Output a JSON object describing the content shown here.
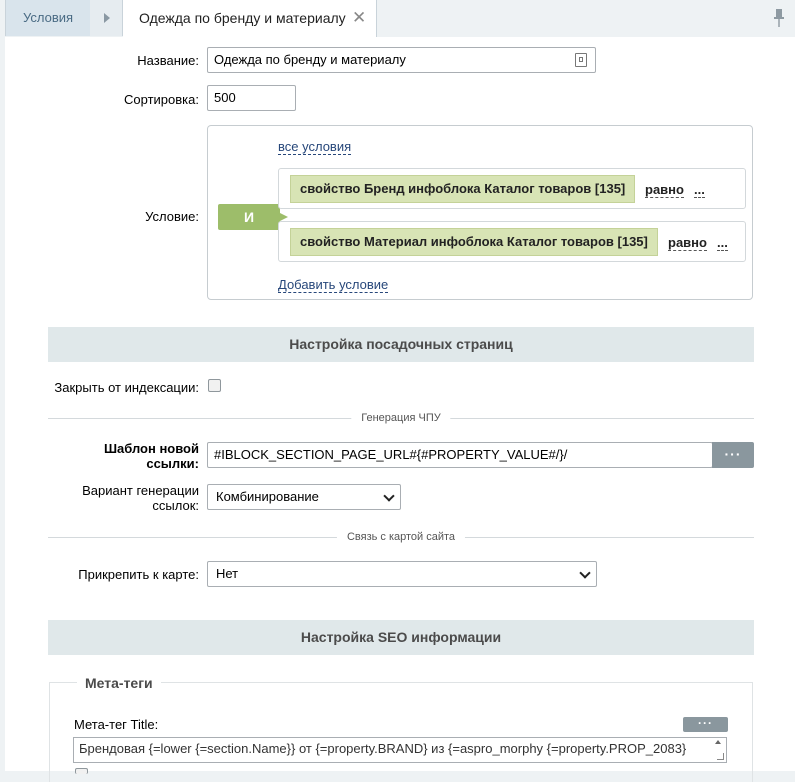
{
  "tabs": {
    "conditions": "Условия",
    "active": "Одежда по бренду и материалу",
    "close_glyph": "✕"
  },
  "form": {
    "name_label": "Название:",
    "name_value": "Одежда по бренду и материалу",
    "sort_label": "Сортировка:",
    "sort_value": "500",
    "condition_label": "Условие:"
  },
  "condition": {
    "all_conditions": "все условия",
    "logic": "И",
    "rules": [
      {
        "property": "свойство Бренд инфоблока Каталог товаров [135]",
        "operator": "равно",
        "value": "..."
      },
      {
        "property": "свойство Материал инфоблока Каталог товаров [135]",
        "operator": "равно",
        "value": "..."
      }
    ],
    "add": "Добавить условие"
  },
  "landing": {
    "header": "Настройка посадочных страниц",
    "noindex_label": "Закрыть от индексации:",
    "noindex_checked": false,
    "sef_divider": "Генерация ЧПУ",
    "template_label_1": "Шаблон новой",
    "template_label_2": "ссылки:",
    "template_value": "#IBLOCK_SECTION_PAGE_URL#{#PROPERTY_VALUE#/}/",
    "more_button": "···",
    "variant_label_1": "Вариант генерации",
    "variant_label_2": "ссылок:",
    "variant_value": "Комбинирование",
    "sitemap_divider": "Связь с картой сайта",
    "attach_label": "Прикрепить к карте:",
    "attach_value": "Нет"
  },
  "seo": {
    "header": "Настройка SEO информации",
    "meta_legend": "Мета-теги",
    "meta_title_label": "Мета-тег Title:",
    "more_button": "···",
    "meta_title_value": "Брендовая {=lower {=section.Name}} от {=property.BRAND} из {=aspro_morphy {=property.PROP_2083}"
  },
  "colors": {
    "accent": "#27477a",
    "condition_green": "#9dbd6a",
    "property_fill": "#d8e4b5",
    "section_header": "#e0e8ea"
  }
}
